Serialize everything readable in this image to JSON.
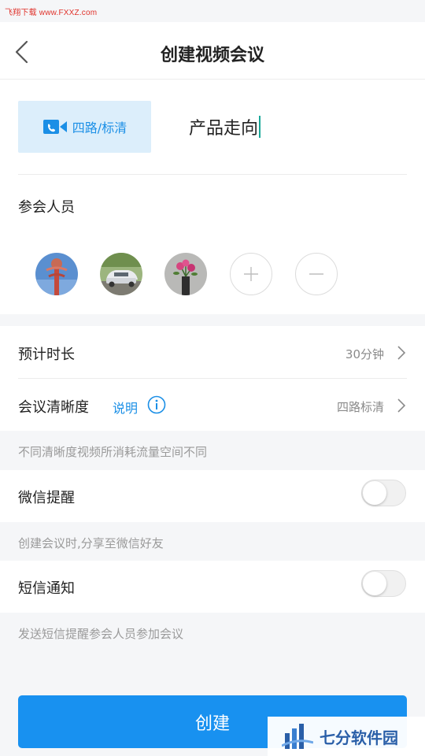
{
  "watermark": {
    "top_text": "飞翔下载 www.FXXZ.com",
    "brand_text": "七分软件园"
  },
  "header": {
    "title": "创建视频会议"
  },
  "meeting": {
    "mode_label": "四路/标清",
    "name": "产品走向"
  },
  "participants": {
    "label": "参会人员",
    "avatars": [
      {
        "name": "avatar-tower"
      },
      {
        "name": "avatar-car"
      },
      {
        "name": "avatar-flowers"
      }
    ]
  },
  "duration": {
    "label": "预计时长",
    "value": "30分钟"
  },
  "clarity": {
    "label": "会议清晰度",
    "explain_label": "说明",
    "value": "四路标清"
  },
  "clarity_hint": "不同清晰度视频所消耗流量空间不同",
  "wechat": {
    "label": "微信提醒",
    "enabled": false,
    "hint": "创建会议时,分享至微信好友"
  },
  "sms": {
    "label": "短信通知",
    "enabled": false,
    "hint": "发送短信提醒参会人员参加会议"
  },
  "actions": {
    "create_label": "创建"
  },
  "colors": {
    "accent": "#1891f0",
    "mode_bg": "#dceefb",
    "cursor": "#1aa89a"
  },
  "icons": {
    "back": "chevron-left-icon",
    "video": "video-camera-icon",
    "info": "info-circle-icon",
    "add": "plus-icon",
    "remove": "minus-icon"
  }
}
